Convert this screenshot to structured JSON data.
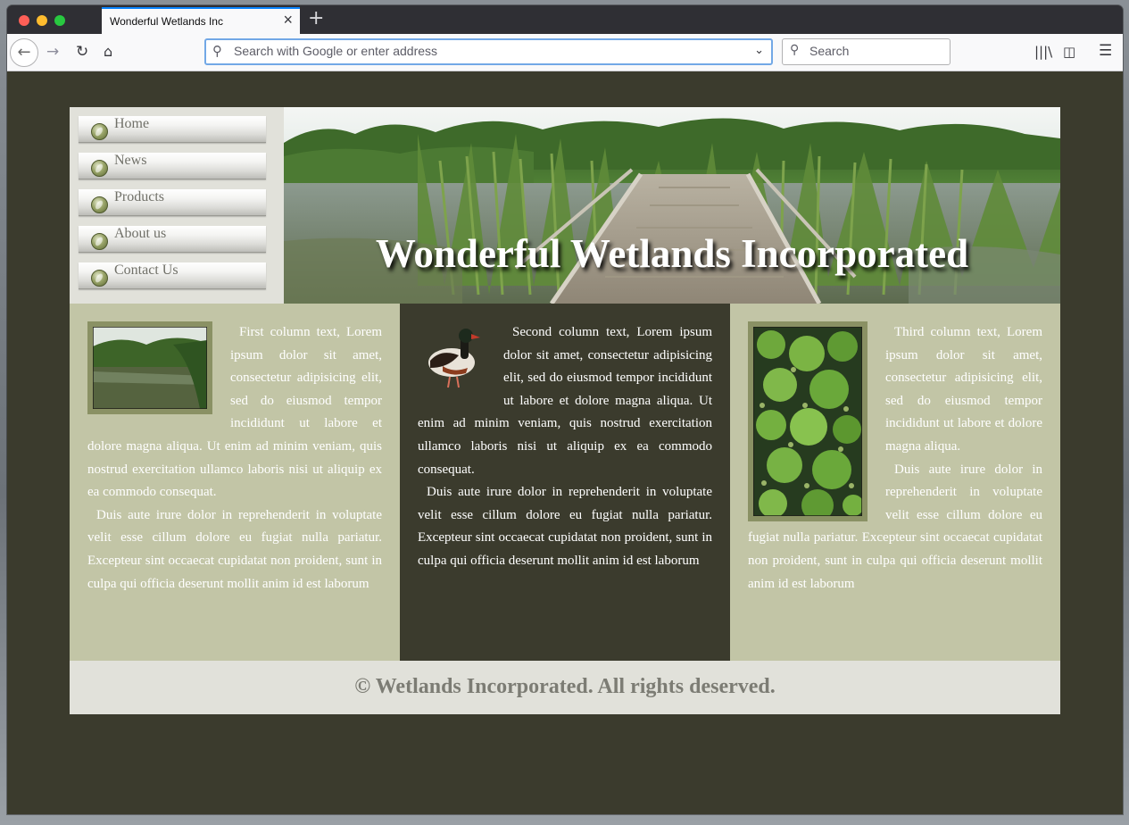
{
  "browser": {
    "tab_title": "Wonderful Wetlands Inc",
    "tab_close_icon": "close-icon",
    "new_tab_icon": "plus-icon",
    "url_placeholder": "Search with Google or enter address",
    "search_placeholder": "Search",
    "toolbar_icons": [
      "back-icon",
      "forward-icon",
      "reload-icon",
      "home-icon",
      "library-icon",
      "sidebar-icon",
      "menu-icon"
    ]
  },
  "nav": {
    "items": [
      {
        "label": "Home"
      },
      {
        "label": "News"
      },
      {
        "label": "Products"
      },
      {
        "label": "About us"
      },
      {
        "label": "Contact Us"
      }
    ]
  },
  "banner": {
    "title": "Wonderful Wetlands Incorporated"
  },
  "columns": [
    {
      "p1": "First column text, Lorem ipsum dolor sit amet, consectetur adipisicing elit, sed do eiusmod tempor incididunt ut labore et dolore magna aliqua. Ut enim ad minim veniam, quis nostrud exercitation ullamco laboris nisi ut aliquip ex ea commodo consequat.",
      "p2": "Duis aute irure dolor in reprehenderit in voluptate velit esse cillum dolore eu fugiat nulla pariatur. Excepteur sint occaecat cupidatat non proident, sunt in culpa qui officia deserunt mollit anim id est laborum"
    },
    {
      "p1": "Second column text, Lorem ipsum dolor sit amet, consectetur adipisicing elit, sed do eiusmod tempor incididunt ut labore et dolore magna aliqua. Ut enim ad minim veniam, quis nostrud exercitation ullamco laboris nisi ut aliquip ex ea commodo consequat.",
      "p2": "Duis aute irure dolor in reprehenderit in voluptate velit esse cillum dolore eu fugiat nulla pariatur. Excepteur sint occaecat cupidatat non proident, sunt in culpa qui officia deserunt mollit anim id est laborum"
    },
    {
      "p1": "Third column text, Lorem ipsum dolor sit amet, consectetur adipisicing elit, sed do eiusmod tempor incididunt ut labore et dolore magna aliqua.",
      "p2": "Duis aute irure dolor in reprehenderit in voluptate velit esse cillum dolore eu fugiat nulla pariatur. Excepteur sint occaecat cupidatat non proident, sunt in culpa qui officia deserunt mollit anim id est laborum"
    }
  ],
  "footer": {
    "text": "© Wetlands Incorporated. All rights deserved."
  },
  "colors": {
    "page_background": "#3b3b2d",
    "column_light": "#c2c5a6",
    "header_panel": "#e1e1da",
    "footer_text": "#7c7c74",
    "url_focus": "#72a8e6"
  }
}
